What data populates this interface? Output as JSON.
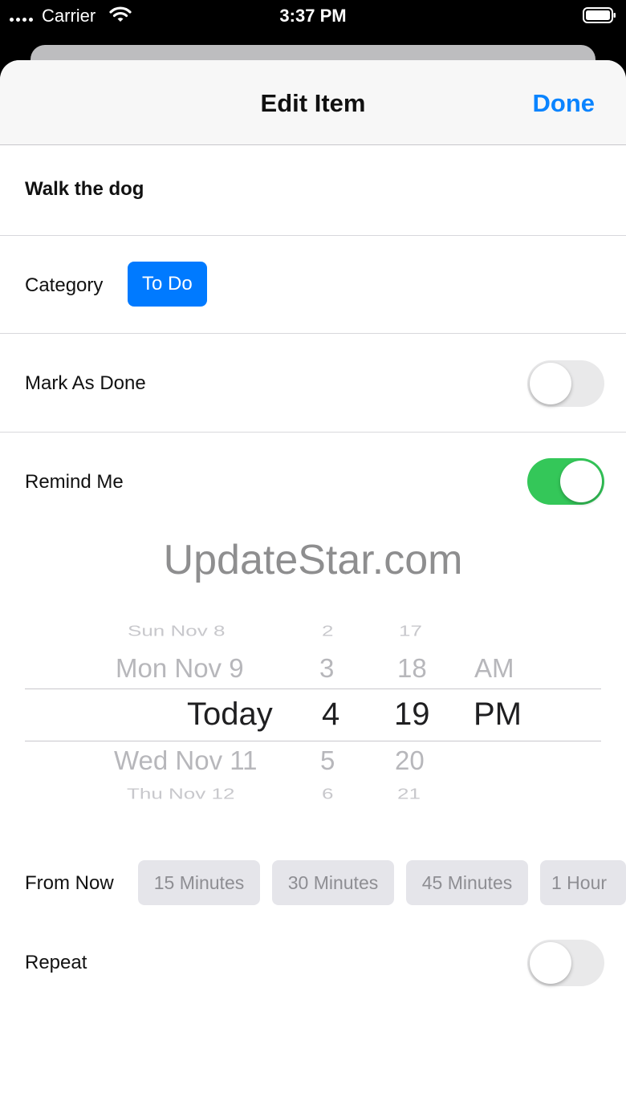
{
  "status_bar": {
    "carrier": "Carrier",
    "time": "3:37 PM"
  },
  "navbar": {
    "title": "Edit Item",
    "done_label": "Done"
  },
  "item": {
    "title": "Walk the dog"
  },
  "category": {
    "label": "Category",
    "value": "To Do"
  },
  "mark_done": {
    "label": "Mark As Done",
    "on": false
  },
  "remind_me": {
    "label": "Remind Me",
    "on": true
  },
  "picker": {
    "date_column": [
      "Sun Nov 8",
      "Mon Nov 9",
      "Today",
      "Wed Nov 11",
      "Thu Nov 12"
    ],
    "hour_column": [
      "2",
      "3",
      "4",
      "5",
      "6"
    ],
    "minute_column": [
      "17",
      "18",
      "19",
      "20",
      "21"
    ],
    "ampm_column": [
      "AM",
      "PM"
    ]
  },
  "watermark": "UpdateStar.com",
  "from_now": {
    "label": "From Now",
    "options": [
      "15 Minutes",
      "30 Minutes",
      "45 Minutes",
      "1 Hour"
    ]
  },
  "repeat": {
    "label": "Repeat",
    "on": false
  },
  "colors": {
    "accent": "#007aff",
    "done_text": "#0a84ff",
    "toggle_on": "#34c759",
    "toggle_off": "#e9e9ea"
  }
}
